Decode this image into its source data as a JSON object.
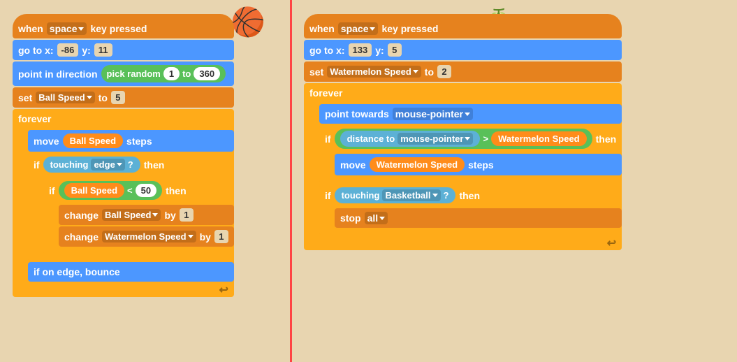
{
  "left_script": {
    "hat": {
      "event": "when",
      "key": "space",
      "label": "key pressed"
    },
    "goto": {
      "label": "go to x:",
      "x": "-86",
      "y_label": "y:",
      "y": "11"
    },
    "point": {
      "label": "point in direction",
      "pick_label": "pick random",
      "from": "1",
      "to": "360"
    },
    "set_var": {
      "label": "set",
      "var": "Ball Speed",
      "to_label": "to",
      "val": "5"
    },
    "forever": {
      "label": "forever"
    },
    "move": {
      "label": "move",
      "var": "Ball Speed",
      "steps": "steps"
    },
    "if_edge": {
      "label": "if",
      "cond": "touching",
      "var": "edge",
      "q": "?",
      "then": "then"
    },
    "if_speed": {
      "label": "if",
      "var": "Ball Speed",
      "op": "<",
      "val": "50",
      "then": "then"
    },
    "change1": {
      "label": "change",
      "var": "Ball Speed",
      "by_label": "by",
      "val": "1"
    },
    "change2": {
      "label": "change",
      "var": "Watermelon Speed",
      "by_label": "by",
      "val": "1"
    },
    "bounce": {
      "label": "if on edge, bounce"
    },
    "refresh_icon": "↩"
  },
  "right_script": {
    "hat": {
      "event": "when",
      "key": "space",
      "label": "key pressed"
    },
    "goto": {
      "label": "go to x:",
      "x": "133",
      "y_label": "y:",
      "y": "5"
    },
    "set_var": {
      "label": "set",
      "var": "Watermelon Speed",
      "to_label": "to",
      "val": "2"
    },
    "forever": {
      "label": "forever"
    },
    "point_towards": {
      "label": "point towards",
      "target": "mouse-pointer"
    },
    "if_dist": {
      "label": "if",
      "dist_label": "distance to",
      "dist_var": "mouse-pointer",
      "op": ">",
      "speed_var": "Watermelon Speed",
      "then": "then"
    },
    "move": {
      "label": "move",
      "var": "Watermelon Speed",
      "steps": "steps"
    },
    "if_touch": {
      "label": "if",
      "cond": "touching",
      "var": "Basketball",
      "q": "?",
      "then": "then"
    },
    "stop": {
      "label": "stop",
      "var": "all"
    },
    "refresh_icon": "↩"
  },
  "basketball_icon": "🏀",
  "watermelon_icon": "🍈"
}
